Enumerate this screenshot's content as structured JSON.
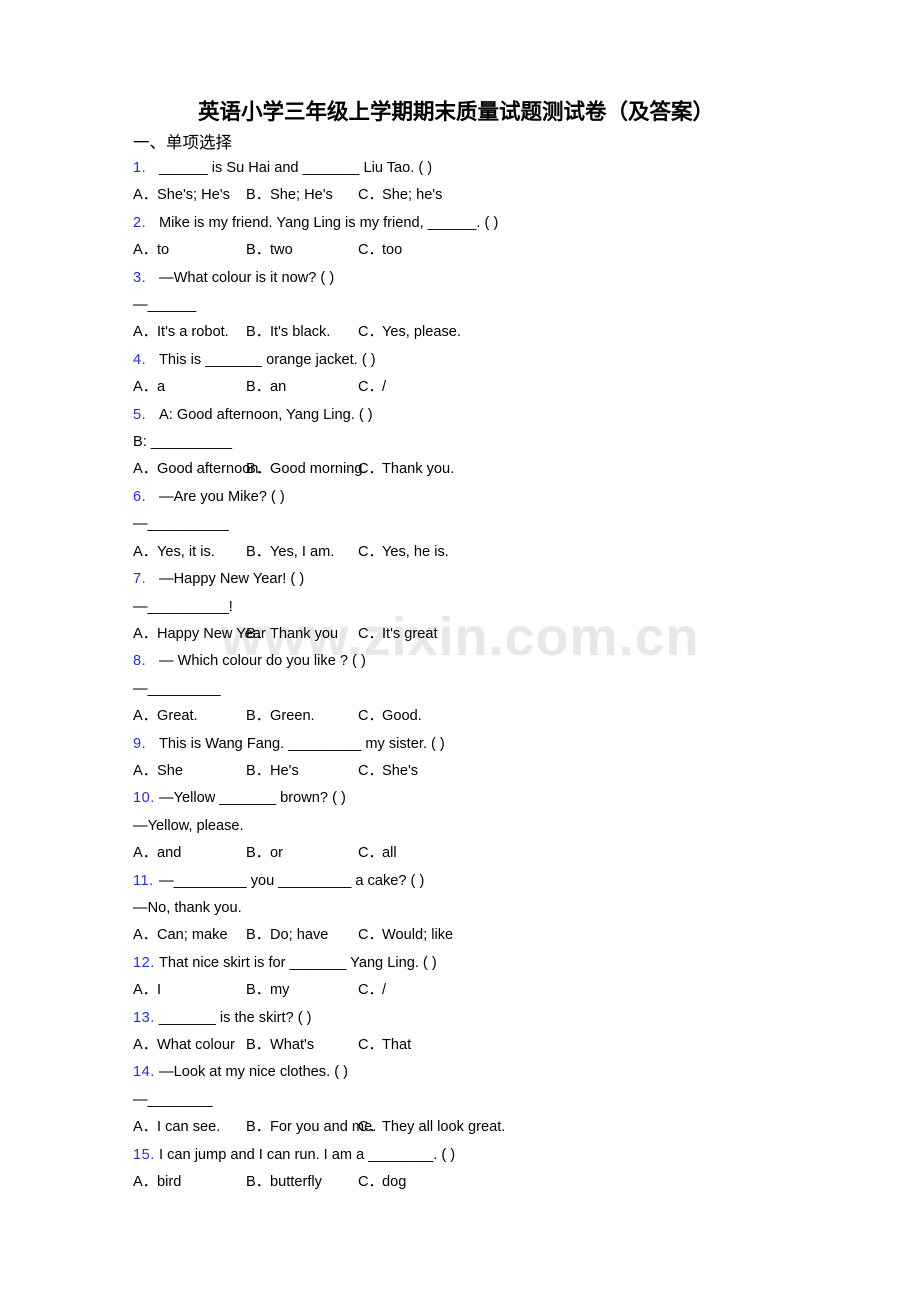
{
  "document": {
    "title": "英语小学三年级上学期期末质量试题测试卷（及答案）",
    "watermark": "www.zixin.com.cn"
  },
  "section": {
    "heading": "一、单项选择"
  },
  "questions": [
    {
      "num": "1.",
      "stem": "______ is Su Hai and _______ Liu Tao. (   )",
      "cont": null,
      "options": [
        {
          "key": "A．",
          "text": "She's; He's"
        },
        {
          "key": "B．",
          "text": "She; He's"
        },
        {
          "key": "C．",
          "text": "She; he's"
        }
      ]
    },
    {
      "num": "2.",
      "stem": "Mike is my friend. Yang Ling is my friend, ______. (   )",
      "cont": null,
      "options": [
        {
          "key": "A．",
          "text": "to"
        },
        {
          "key": "B．",
          "text": "two"
        },
        {
          "key": "C．",
          "text": "too"
        }
      ]
    },
    {
      "num": "3.",
      "stem": "—What colour is it now? (   )",
      "cont": "—______",
      "options": [
        {
          "key": "A．",
          "text": "It's a robot."
        },
        {
          "key": "B．",
          "text": "It's black."
        },
        {
          "key": "C．",
          "text": "Yes, please."
        }
      ]
    },
    {
      "num": "4.",
      "stem": "This is _______ orange jacket. (   )",
      "cont": null,
      "options": [
        {
          "key": "A．",
          "text": "a"
        },
        {
          "key": "B．",
          "text": "an"
        },
        {
          "key": "C．",
          "text": "/"
        }
      ]
    },
    {
      "num": "5.",
      "stem": "A: Good afternoon, Yang Ling. (     )",
      "cont": "B: __________",
      "options": [
        {
          "key": "A．",
          "text": "Good afternoon."
        },
        {
          "key": "B．",
          "text": "Good morning."
        },
        {
          "key": "C．",
          "text": "Thank you."
        }
      ]
    },
    {
      "num": "6.",
      "stem": "—Are you Mike? (   )",
      "cont": "—__________",
      "options": [
        {
          "key": "A．",
          "text": "Yes, it is."
        },
        {
          "key": "B．",
          "text": "Yes, I am."
        },
        {
          "key": "C．",
          "text": "Yes, he is."
        }
      ]
    },
    {
      "num": "7.",
      "stem": "—Happy New Year! (   )",
      "cont": "—__________!",
      "options": [
        {
          "key": "A．",
          "text": "Happy New Year"
        },
        {
          "key": "B．",
          "text": "Thank you"
        },
        {
          "key": "C．",
          "text": "It's great"
        }
      ]
    },
    {
      "num": "8.",
      "stem": "— Which colour do you like ? (   )",
      "cont": "—_________",
      "options": [
        {
          "key": "A．",
          "text": "Great."
        },
        {
          "key": "B．",
          "text": "Green."
        },
        {
          "key": "C．",
          "text": "Good."
        }
      ]
    },
    {
      "num": "9.",
      "stem": "This is Wang Fang. _________ my sister. (   )",
      "cont": null,
      "options": [
        {
          "key": "A．",
          "text": "She"
        },
        {
          "key": "B．",
          "text": "He's"
        },
        {
          "key": "C．",
          "text": "She's"
        }
      ]
    },
    {
      "num": "10.",
      "stem": "—Yellow _______ brown? (   )",
      "cont": "—Yellow, please.",
      "options": [
        {
          "key": "A．",
          "text": "and"
        },
        {
          "key": "B．",
          "text": "or"
        },
        {
          "key": "C．",
          "text": "all"
        }
      ]
    },
    {
      "num": "11.",
      "stem": "—_________ you _________ a cake? (   )",
      "cont": "—No, thank you.",
      "options": [
        {
          "key": "A．",
          "text": "Can; make"
        },
        {
          "key": "B．",
          "text": "Do; have"
        },
        {
          "key": "C．",
          "text": "Would; like"
        }
      ]
    },
    {
      "num": "12.",
      "stem": "That nice skirt is for _______ Yang Ling. (   )",
      "cont": null,
      "options": [
        {
          "key": "A．",
          "text": "I"
        },
        {
          "key": "B．",
          "text": "my"
        },
        {
          "key": "C．",
          "text": "/"
        }
      ]
    },
    {
      "num": "13.",
      "stem": "_______ is the skirt? (   )",
      "cont": null,
      "options": [
        {
          "key": "A．",
          "text": "What colour"
        },
        {
          "key": "B．",
          "text": "What's"
        },
        {
          "key": "C．",
          "text": "That"
        }
      ]
    },
    {
      "num": "14.",
      "stem": "—Look at my nice clothes. (   )",
      "cont": "—________",
      "options": [
        {
          "key": "A．",
          "text": "I can see."
        },
        {
          "key": "B．",
          "text": "For you and me."
        },
        {
          "key": "C．",
          "text": "They all look great."
        }
      ]
    },
    {
      "num": "15.",
      "stem": "I can jump and I can run. I am a ________. (   )",
      "cont": null,
      "options": [
        {
          "key": "A．",
          "text": "bird"
        },
        {
          "key": "B．",
          "text": "butterfly"
        },
        {
          "key": "C．",
          "text": "dog"
        }
      ]
    }
  ],
  "colors": {
    "question_number": "#2330d8",
    "text": "#000000",
    "watermark": "#e8e8e8"
  }
}
